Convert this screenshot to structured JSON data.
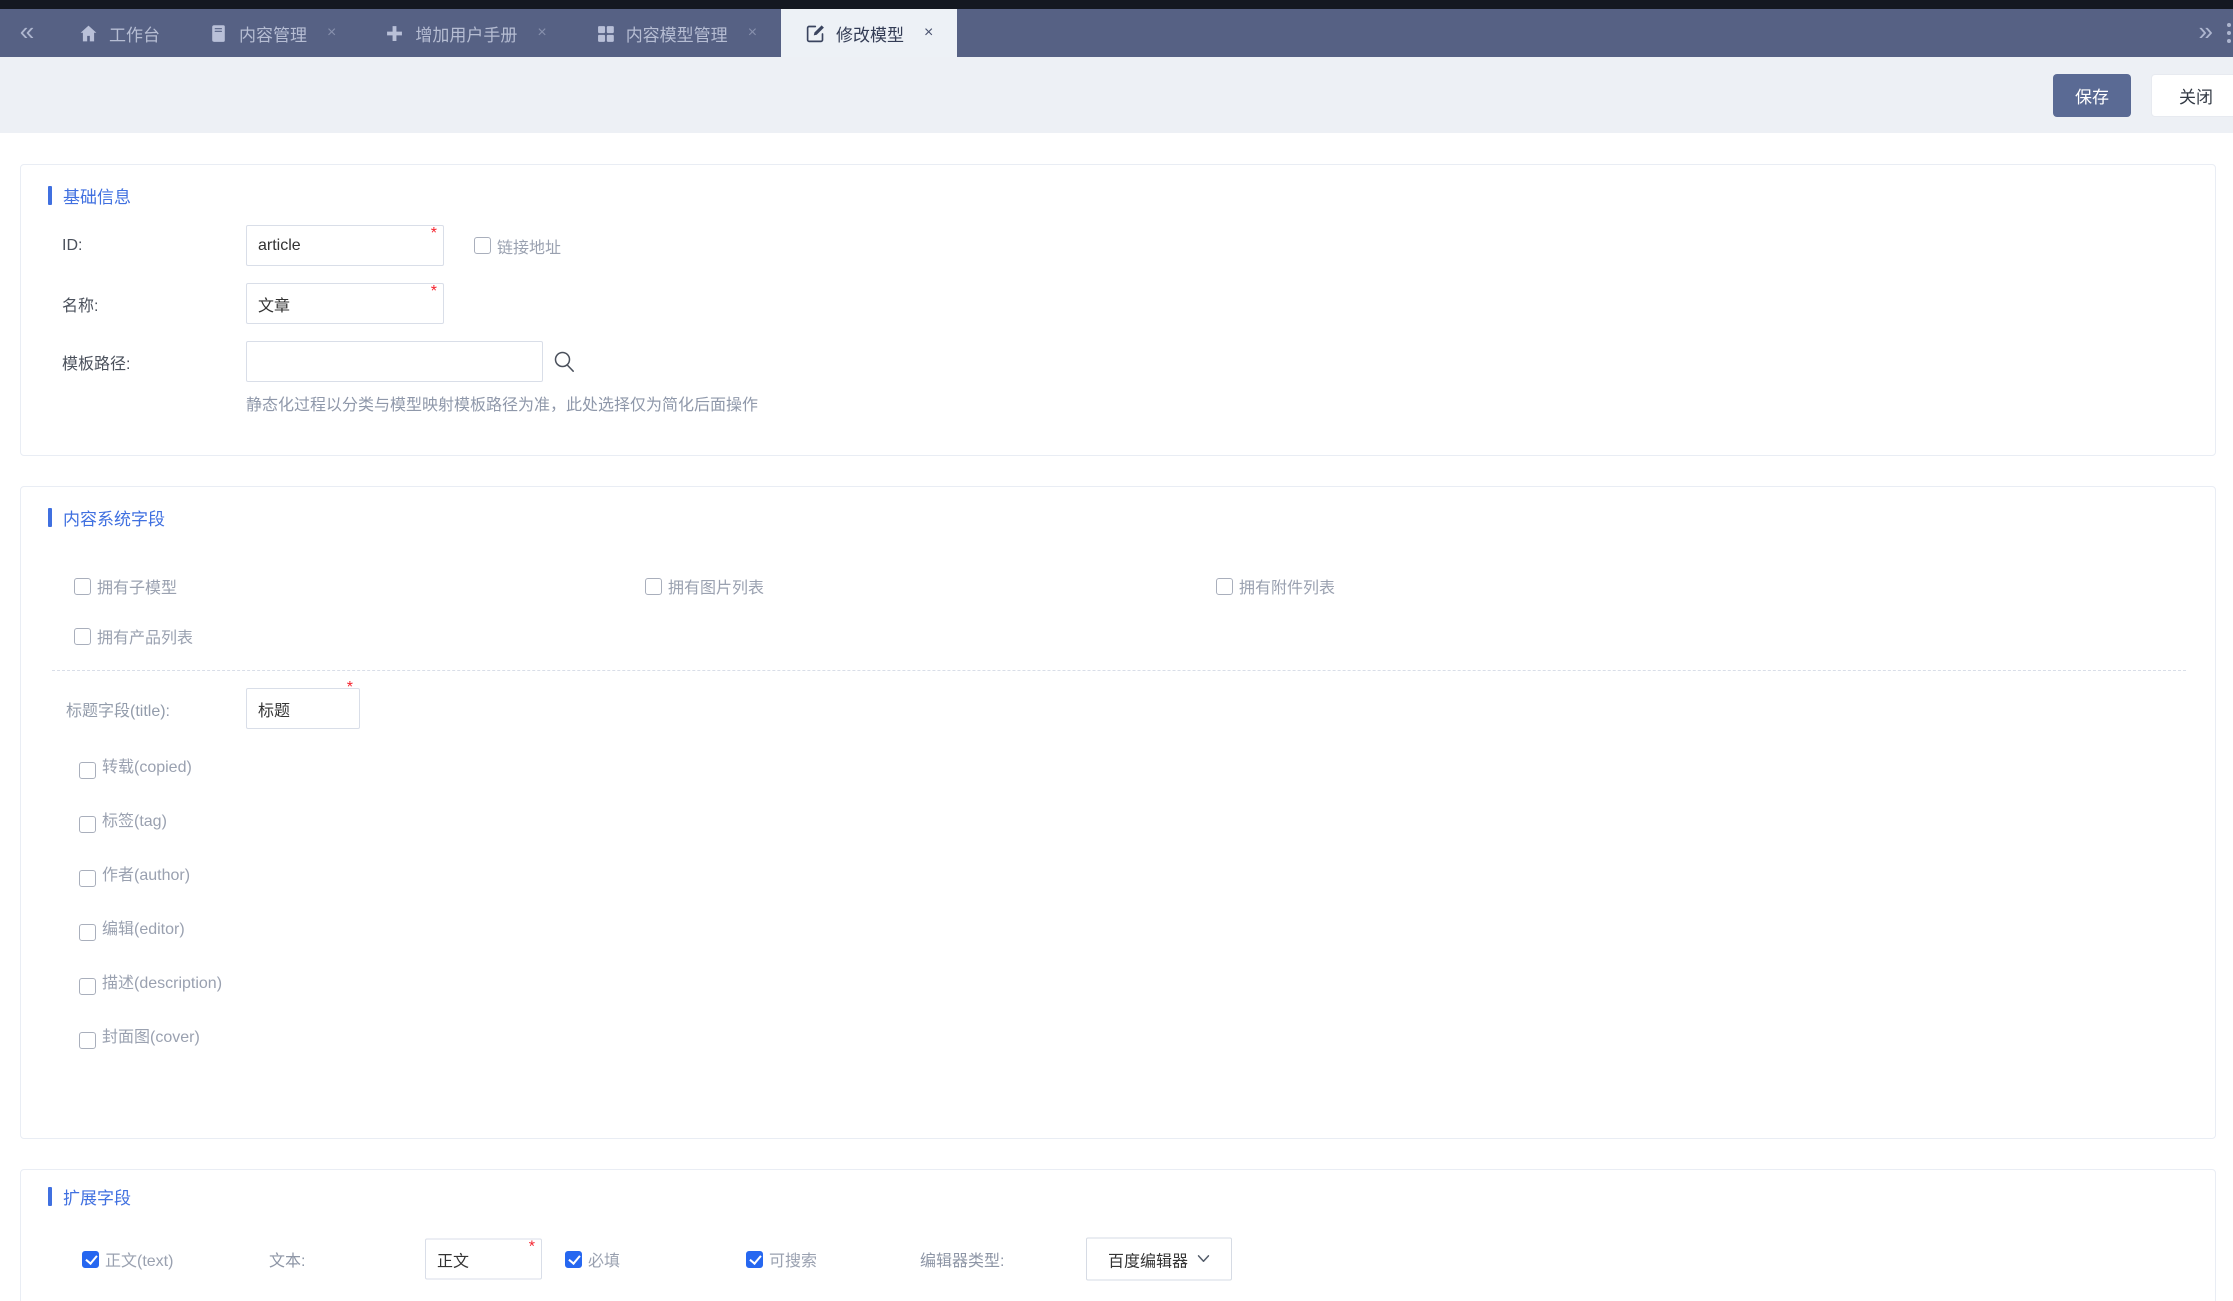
{
  "tabbar": {
    "collapse_icon": "«",
    "expand_icon": "»",
    "tabs": [
      {
        "label": "工作台",
        "icon": "home-icon",
        "closable": false,
        "active": false
      },
      {
        "label": "内容管理",
        "icon": "book-icon",
        "closable": true,
        "active": false,
        "close_icon": "×"
      },
      {
        "label": "增加用户手册",
        "icon": "plus-icon",
        "closable": true,
        "active": false,
        "close_icon": "×"
      },
      {
        "label": "内容模型管理",
        "icon": "grid-icon",
        "closable": true,
        "active": false,
        "close_icon": "×"
      },
      {
        "label": "修改模型",
        "icon": "edit-icon",
        "closable": true,
        "active": true,
        "close_icon": "×"
      }
    ]
  },
  "toolbar": {
    "save_label": "保存",
    "close_label": "关闭"
  },
  "sections": {
    "basic": {
      "title": "基础信息",
      "id_label": "ID:",
      "id_value": "article",
      "link_checkbox": {
        "label": "链接地址",
        "checked": false
      },
      "name_label": "名称:",
      "name_value": "文章",
      "template_label": "模板路径:",
      "template_value": "",
      "template_hint": "静态化过程以分类与模型映射模板路径为准，此处选择仅为简化后面操作"
    },
    "system": {
      "title": "内容系统字段",
      "feature_checkboxes": [
        {
          "label": "拥有子模型",
          "checked": false
        },
        {
          "label": "拥有图片列表",
          "checked": false
        },
        {
          "label": "拥有附件列表",
          "checked": false
        },
        {
          "label": "拥有产品列表",
          "checked": false
        }
      ],
      "title_field_label": "标题字段(title):",
      "title_field_value": "标题",
      "field_checkboxes": [
        {
          "label": "转载(copied)",
          "checked": false
        },
        {
          "label": "标签(tag)",
          "checked": false
        },
        {
          "label": "作者(author)",
          "checked": false
        },
        {
          "label": "编辑(editor)",
          "checked": false
        },
        {
          "label": "描述(description)",
          "checked": false
        },
        {
          "label": "封面图(cover)",
          "checked": false
        }
      ]
    },
    "extension": {
      "title": "扩展字段",
      "row": {
        "field_label": "正文(text)",
        "field_checked": true,
        "text_label": "文本:",
        "text_value": "正文",
        "required_label": "必填",
        "required_checked": true,
        "searchable_label": "可搜索",
        "searchable_checked": true,
        "editor_type_label": "编辑器类型:",
        "editor_type_value": "百度编辑器"
      }
    }
  },
  "colors": {
    "accent_blue": "#4070e0",
    "checkbox_checked_blue": "#2667f0",
    "required_red": "#f5222d",
    "save_button": "#5a6a94",
    "tabbar_bg": "#566184",
    "tab_active_bg": "#edf1f6",
    "toolbar_bg": "#edf0f5",
    "top_strip": "#141821"
  },
  "required_marker": "*"
}
